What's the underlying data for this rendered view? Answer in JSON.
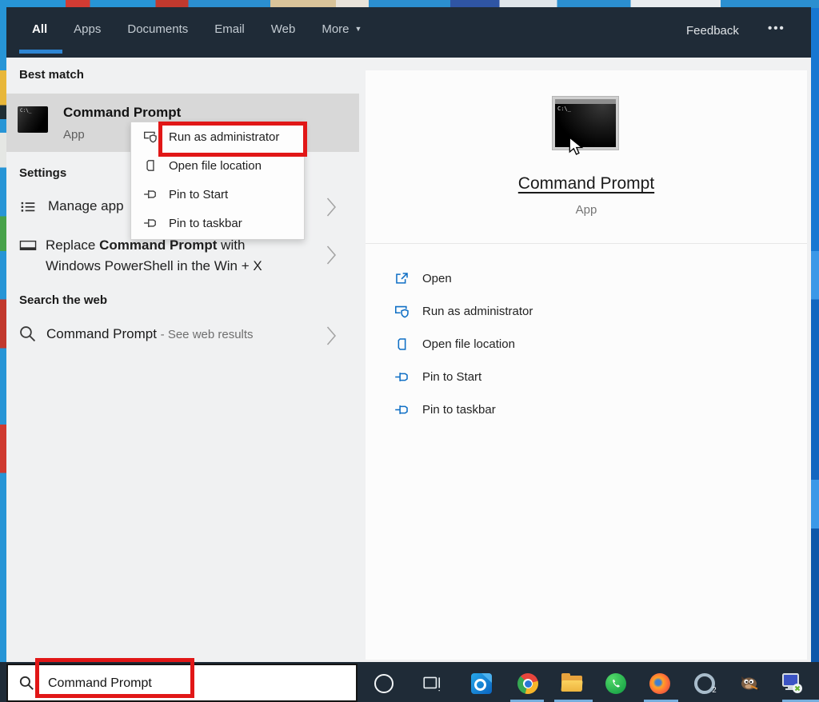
{
  "header": {
    "tabs": [
      "All",
      "Apps",
      "Documents",
      "Email",
      "Web"
    ],
    "more_label": "More",
    "more_caret": "▼",
    "feedback_label": "Feedback",
    "overflow": "•••"
  },
  "left_panel": {
    "best_match_header": "Best match",
    "best_match_title": "Command Prompt",
    "best_match_subtitle": "App",
    "best_match_icon": "cmd-terminal-icon",
    "settings_header": "Settings",
    "manage_app_label": "Manage app",
    "replace_prefix": "Replace ",
    "replace_bold": "Command Prompt",
    "replace_suffix": " with",
    "replace_line2": "Windows PowerShell in the Win + X",
    "search_web_header": "Search the web",
    "web_result_title": "Command Prompt ",
    "web_result_suffix": "- See web results"
  },
  "context_menu": {
    "items": [
      "Run as administrator",
      "Open file location",
      "Pin to Start",
      "Pin to taskbar"
    ],
    "item_icons": [
      "run-admin-icon",
      "file-location-icon",
      "pin-icon",
      "pin-icon"
    ]
  },
  "preview": {
    "app_icon": "cmd-terminal-icon",
    "title": "Command Prompt",
    "subtitle": "App",
    "actions": [
      "Open",
      "Run as administrator",
      "Open file location",
      "Pin to Start",
      "Pin to taskbar"
    ],
    "action_icons": [
      "open-icon",
      "run-admin-icon",
      "file-location-icon",
      "pin-icon",
      "pin-icon"
    ]
  },
  "search_bar": {
    "value": "Command Prompt",
    "icon": "search-icon"
  },
  "taskbar": {
    "icons": [
      "cortana-icon",
      "task-view-icon",
      "outlook-icon",
      "chrome-icon",
      "file-explorer-icon",
      "whatsapp-icon",
      "firefox-icon",
      "o2-ring-icon",
      "gimp-icon",
      "remote-computer-icon"
    ],
    "running_indicators": [
      "chrome-icon",
      "file-explorer-icon",
      "firefox-icon",
      "remote-computer-icon"
    ],
    "o2_badge": "2"
  },
  "cmd_icon_text": "C:\\_",
  "colors": {
    "header_bg": "#1f2b37",
    "taskbar_bg": "#1f2b37",
    "panel_bg": "#f0f1f2",
    "highlight_row": "#d8d8d8",
    "accent_blue": "#0f6fc5",
    "tab_underline": "#2e86d4",
    "annotation_red": "#e11717"
  }
}
